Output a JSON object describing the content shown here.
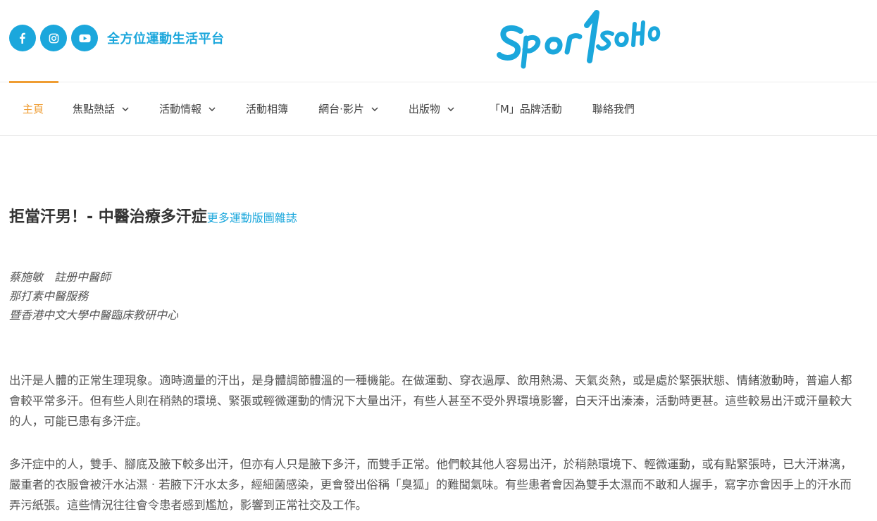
{
  "header": {
    "social": [
      {
        "name": "facebook-icon",
        "glyph": "f"
      },
      {
        "name": "instagram-icon",
        "glyph": "ig"
      },
      {
        "name": "youtube-icon",
        "glyph": "yt"
      }
    ],
    "tagline": "全方位運動生活平台",
    "logo_text": "SPOR1SOHO",
    "brand_color": "#1ba7dc",
    "accent_color": "#ef9d33"
  },
  "nav": {
    "items": [
      {
        "label": "主頁",
        "active": true,
        "dropdown": false
      },
      {
        "label": "焦點熱話",
        "active": false,
        "dropdown": true
      },
      {
        "label": "活動情報",
        "active": false,
        "dropdown": true
      },
      {
        "label": "活動相簿",
        "active": false,
        "dropdown": false
      },
      {
        "label": "網台‧影片",
        "active": false,
        "dropdown": true
      },
      {
        "label": "出版物",
        "active": false,
        "dropdown": true
      },
      {
        "label": "「M」品牌活動",
        "active": false,
        "dropdown": false
      },
      {
        "label": "聯絡我們",
        "active": false,
        "dropdown": false
      }
    ]
  },
  "article": {
    "title": "拒當汗男！- 中醫治療多汗症",
    "more_link": "更多運動版圖雜誌",
    "author_lines": [
      "蔡施敏　註册中醫師",
      "那打素中醫服務",
      "暨香港中文大學中醫臨床教研中心"
    ],
    "paragraph1": "出汗是人體的正常生理現象。適時適量的汗出，是身體調節體溫的一種機能。在做運動、穿衣過厚、飲用熱湯、天氣炎熱，或是處於緊張狀態、情緒激動時，普遍人都會較平常多汗。但有些人則在稍熱的環境、緊張或輕微運動的情況下大量出汗，有些人甚至不受外界環境影響，白天汗出溱溱，活動時更甚。這些較易出汗或汗量較大的人，可能已患有多汗症。",
    "paragraph2": "多汗症中的人，雙手、腳底及腋下較多出汗，但亦有人只是腋下多汗，而雙手正常。他們較其他人容易出汗，於稍熱環境下、輕微運動，或有點緊張時，已大汗淋漓，嚴重者的衣服會被汗水沾濕 · 若腋下汗水太多，經細菌感染，更會發出俗稱「臭狐」的難聞氣味。有些患者會因為雙手太濕而不敢和人握手，寫字亦會因手上的汗水而弄污紙張。這些情況往往會令患者感到尷尬，影響到正常社交及工作。"
  }
}
